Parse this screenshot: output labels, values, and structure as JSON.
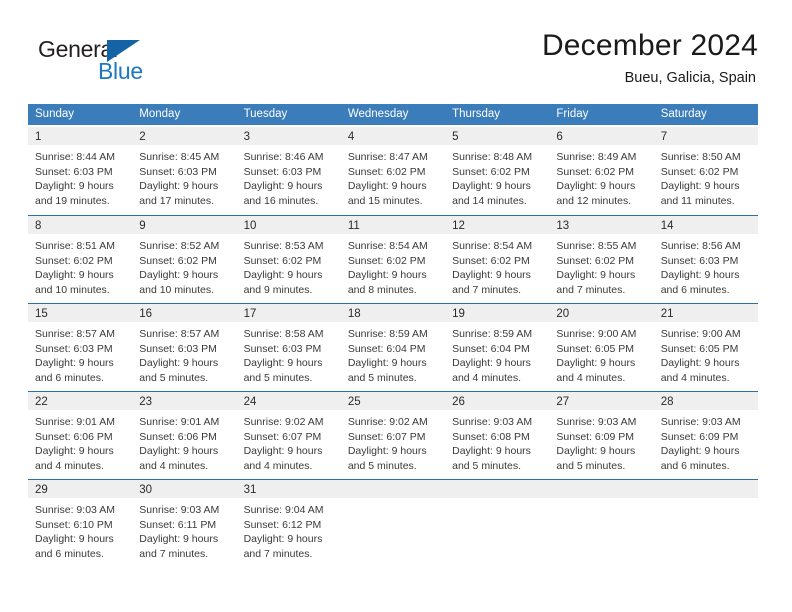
{
  "brand": {
    "name_part1": "General",
    "name_part2": "Blue",
    "accent_color": "#1e78c2",
    "triangle_color": "#1464a5"
  },
  "header": {
    "title": "December 2024",
    "location": "Bueu, Galicia, Spain"
  },
  "theme": {
    "header_bg": "#3b7cba",
    "week_divider": "#2f6fa8",
    "day_number_band": "#efefef",
    "text": "#3a3a3a"
  },
  "weekdays": [
    "Sunday",
    "Monday",
    "Tuesday",
    "Wednesday",
    "Thursday",
    "Friday",
    "Saturday"
  ],
  "weeks": [
    [
      {
        "day": "1",
        "sunrise": "Sunrise: 8:44 AM",
        "sunset": "Sunset: 6:03 PM",
        "daylight1": "Daylight: 9 hours",
        "daylight2": "and 19 minutes."
      },
      {
        "day": "2",
        "sunrise": "Sunrise: 8:45 AM",
        "sunset": "Sunset: 6:03 PM",
        "daylight1": "Daylight: 9 hours",
        "daylight2": "and 17 minutes."
      },
      {
        "day": "3",
        "sunrise": "Sunrise: 8:46 AM",
        "sunset": "Sunset: 6:03 PM",
        "daylight1": "Daylight: 9 hours",
        "daylight2": "and 16 minutes."
      },
      {
        "day": "4",
        "sunrise": "Sunrise: 8:47 AM",
        "sunset": "Sunset: 6:02 PM",
        "daylight1": "Daylight: 9 hours",
        "daylight2": "and 15 minutes."
      },
      {
        "day": "5",
        "sunrise": "Sunrise: 8:48 AM",
        "sunset": "Sunset: 6:02 PM",
        "daylight1": "Daylight: 9 hours",
        "daylight2": "and 14 minutes."
      },
      {
        "day": "6",
        "sunrise": "Sunrise: 8:49 AM",
        "sunset": "Sunset: 6:02 PM",
        "daylight1": "Daylight: 9 hours",
        "daylight2": "and 12 minutes."
      },
      {
        "day": "7",
        "sunrise": "Sunrise: 8:50 AM",
        "sunset": "Sunset: 6:02 PM",
        "daylight1": "Daylight: 9 hours",
        "daylight2": "and 11 minutes."
      }
    ],
    [
      {
        "day": "8",
        "sunrise": "Sunrise: 8:51 AM",
        "sunset": "Sunset: 6:02 PM",
        "daylight1": "Daylight: 9 hours",
        "daylight2": "and 10 minutes."
      },
      {
        "day": "9",
        "sunrise": "Sunrise: 8:52 AM",
        "sunset": "Sunset: 6:02 PM",
        "daylight1": "Daylight: 9 hours",
        "daylight2": "and 10 minutes."
      },
      {
        "day": "10",
        "sunrise": "Sunrise: 8:53 AM",
        "sunset": "Sunset: 6:02 PM",
        "daylight1": "Daylight: 9 hours",
        "daylight2": "and 9 minutes."
      },
      {
        "day": "11",
        "sunrise": "Sunrise: 8:54 AM",
        "sunset": "Sunset: 6:02 PM",
        "daylight1": "Daylight: 9 hours",
        "daylight2": "and 8 minutes."
      },
      {
        "day": "12",
        "sunrise": "Sunrise: 8:54 AM",
        "sunset": "Sunset: 6:02 PM",
        "daylight1": "Daylight: 9 hours",
        "daylight2": "and 7 minutes."
      },
      {
        "day": "13",
        "sunrise": "Sunrise: 8:55 AM",
        "sunset": "Sunset: 6:02 PM",
        "daylight1": "Daylight: 9 hours",
        "daylight2": "and 7 minutes."
      },
      {
        "day": "14",
        "sunrise": "Sunrise: 8:56 AM",
        "sunset": "Sunset: 6:03 PM",
        "daylight1": "Daylight: 9 hours",
        "daylight2": "and 6 minutes."
      }
    ],
    [
      {
        "day": "15",
        "sunrise": "Sunrise: 8:57 AM",
        "sunset": "Sunset: 6:03 PM",
        "daylight1": "Daylight: 9 hours",
        "daylight2": "and 6 minutes."
      },
      {
        "day": "16",
        "sunrise": "Sunrise: 8:57 AM",
        "sunset": "Sunset: 6:03 PM",
        "daylight1": "Daylight: 9 hours",
        "daylight2": "and 5 minutes."
      },
      {
        "day": "17",
        "sunrise": "Sunrise: 8:58 AM",
        "sunset": "Sunset: 6:03 PM",
        "daylight1": "Daylight: 9 hours",
        "daylight2": "and 5 minutes."
      },
      {
        "day": "18",
        "sunrise": "Sunrise: 8:59 AM",
        "sunset": "Sunset: 6:04 PM",
        "daylight1": "Daylight: 9 hours",
        "daylight2": "and 5 minutes."
      },
      {
        "day": "19",
        "sunrise": "Sunrise: 8:59 AM",
        "sunset": "Sunset: 6:04 PM",
        "daylight1": "Daylight: 9 hours",
        "daylight2": "and 4 minutes."
      },
      {
        "day": "20",
        "sunrise": "Sunrise: 9:00 AM",
        "sunset": "Sunset: 6:05 PM",
        "daylight1": "Daylight: 9 hours",
        "daylight2": "and 4 minutes."
      },
      {
        "day": "21",
        "sunrise": "Sunrise: 9:00 AM",
        "sunset": "Sunset: 6:05 PM",
        "daylight1": "Daylight: 9 hours",
        "daylight2": "and 4 minutes."
      }
    ],
    [
      {
        "day": "22",
        "sunrise": "Sunrise: 9:01 AM",
        "sunset": "Sunset: 6:06 PM",
        "daylight1": "Daylight: 9 hours",
        "daylight2": "and 4 minutes."
      },
      {
        "day": "23",
        "sunrise": "Sunrise: 9:01 AM",
        "sunset": "Sunset: 6:06 PM",
        "daylight1": "Daylight: 9 hours",
        "daylight2": "and 4 minutes."
      },
      {
        "day": "24",
        "sunrise": "Sunrise: 9:02 AM",
        "sunset": "Sunset: 6:07 PM",
        "daylight1": "Daylight: 9 hours",
        "daylight2": "and 4 minutes."
      },
      {
        "day": "25",
        "sunrise": "Sunrise: 9:02 AM",
        "sunset": "Sunset: 6:07 PM",
        "daylight1": "Daylight: 9 hours",
        "daylight2": "and 5 minutes."
      },
      {
        "day": "26",
        "sunrise": "Sunrise: 9:03 AM",
        "sunset": "Sunset: 6:08 PM",
        "daylight1": "Daylight: 9 hours",
        "daylight2": "and 5 minutes."
      },
      {
        "day": "27",
        "sunrise": "Sunrise: 9:03 AM",
        "sunset": "Sunset: 6:09 PM",
        "daylight1": "Daylight: 9 hours",
        "daylight2": "and 5 minutes."
      },
      {
        "day": "28",
        "sunrise": "Sunrise: 9:03 AM",
        "sunset": "Sunset: 6:09 PM",
        "daylight1": "Daylight: 9 hours",
        "daylight2": "and 6 minutes."
      }
    ],
    [
      {
        "day": "29",
        "sunrise": "Sunrise: 9:03 AM",
        "sunset": "Sunset: 6:10 PM",
        "daylight1": "Daylight: 9 hours",
        "daylight2": "and 6 minutes."
      },
      {
        "day": "30",
        "sunrise": "Sunrise: 9:03 AM",
        "sunset": "Sunset: 6:11 PM",
        "daylight1": "Daylight: 9 hours",
        "daylight2": "and 7 minutes."
      },
      {
        "day": "31",
        "sunrise": "Sunrise: 9:04 AM",
        "sunset": "Sunset: 6:12 PM",
        "daylight1": "Daylight: 9 hours",
        "daylight2": "and 7 minutes."
      },
      {
        "day": "",
        "sunrise": "",
        "sunset": "",
        "daylight1": "",
        "daylight2": ""
      },
      {
        "day": "",
        "sunrise": "",
        "sunset": "",
        "daylight1": "",
        "daylight2": ""
      },
      {
        "day": "",
        "sunrise": "",
        "sunset": "",
        "daylight1": "",
        "daylight2": ""
      },
      {
        "day": "",
        "sunrise": "",
        "sunset": "",
        "daylight1": "",
        "daylight2": ""
      }
    ]
  ]
}
